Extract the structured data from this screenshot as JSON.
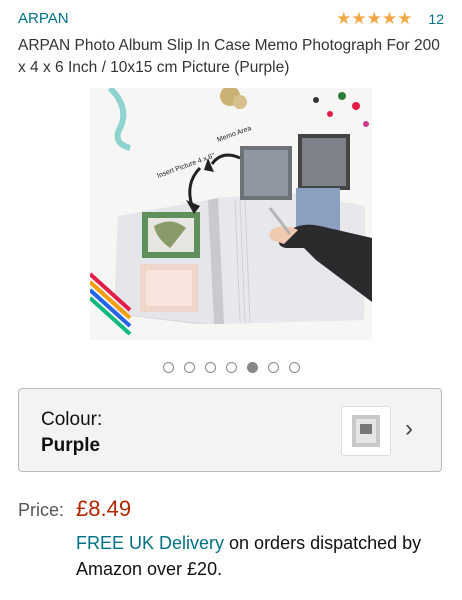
{
  "header": {
    "brand": "ARPAN",
    "rating_count": "12",
    "stars": 5
  },
  "product": {
    "title": "ARPAN Photo Album Slip In Case Memo Photograph For 200 x 4 x 6 Inch / 10x15 cm Picture (Purple)"
  },
  "image": {
    "annotation_left": "Insert Picture 4 x 6\"",
    "annotation_right": "Memo Area"
  },
  "carousel": {
    "count": 7,
    "active_index": 4
  },
  "variant": {
    "label": "Colour:",
    "value": "Purple"
  },
  "price": {
    "label": "Price:",
    "value": "£8.49"
  },
  "delivery": {
    "link_text": "FREE UK Delivery",
    "rest_text": " on orders dispatched by Amazon over £20."
  },
  "colors": {
    "link": "#007185",
    "price": "#b12704",
    "star": "#f3a847"
  }
}
